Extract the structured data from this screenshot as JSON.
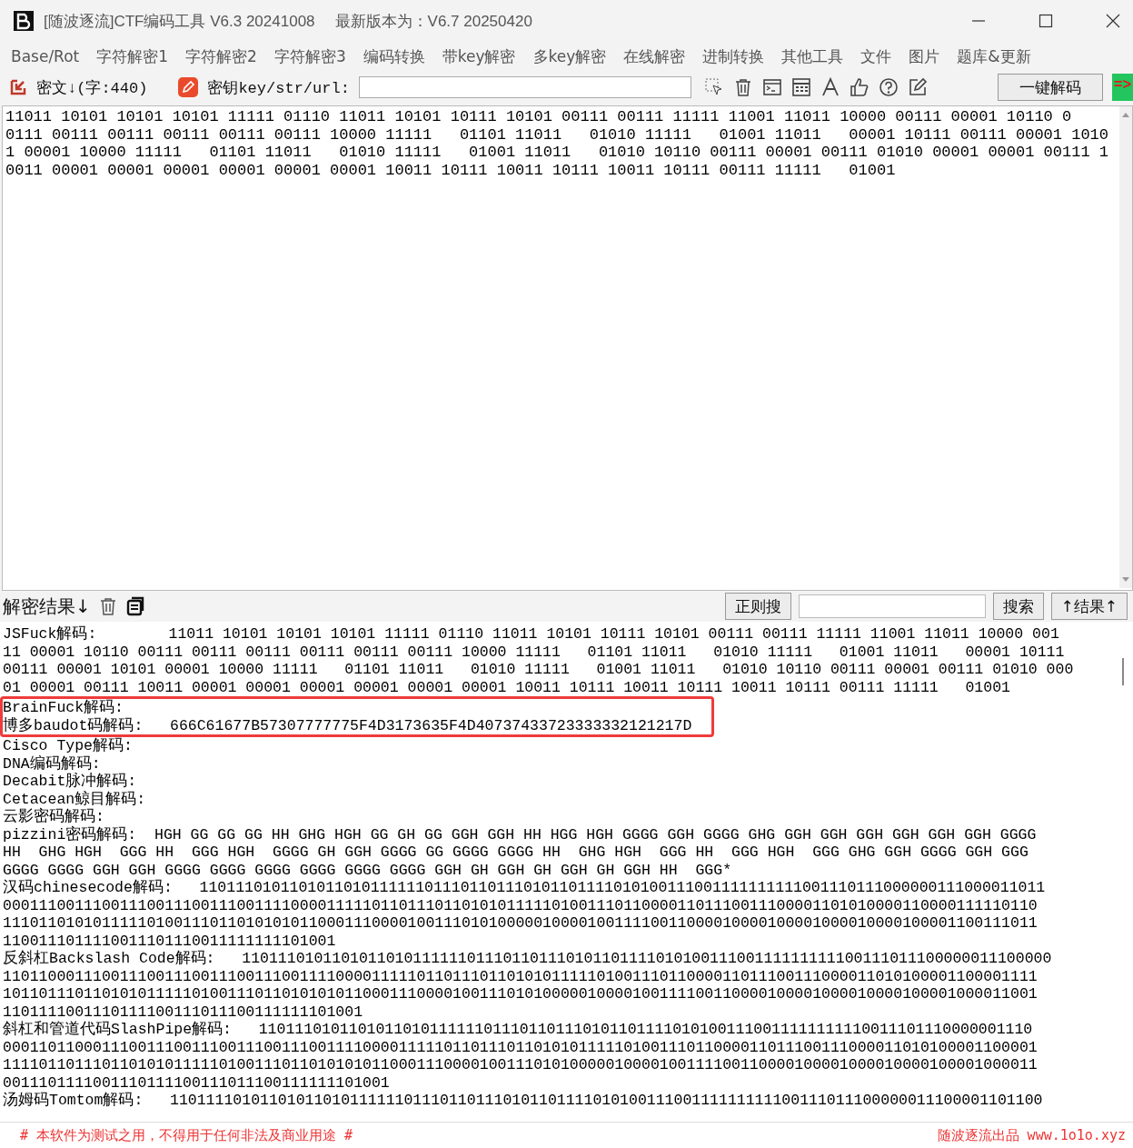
{
  "window": {
    "title": "[随波逐流]CTF编码工具 V6.3 20241008",
    "latest_version": "最新版本为：V6.7 20250420"
  },
  "menu": [
    "Base/Rot",
    "字符解密1",
    "字符解密2",
    "字符解密3",
    "编码转换",
    "带key解密",
    "多key解密",
    "在线解密",
    "进制转换",
    "其他工具",
    "文件",
    "图片",
    "题库&更新"
  ],
  "toolbar": {
    "input_label": "密文↓(字:440)",
    "key_label": "密钥key/str/url:",
    "decode_button": "一键解码",
    "arrow": "=>"
  },
  "input_lines": [
    "11011 10101 10101 10101 11111 01110 11011 10101 10111 10101 00111 00111 11111 11001 11011 10000 00111 00001 10110 0",
    "0111 00111 00111 00111 00111 00111 10000 11111   01101 11011   01010 11111   01001 11011   00001 10111 00111 00001 1010",
    "1 00001 10000 11111   01101 11011   01010 11111   01001 11011   01010 10110 00111 00001 00111 01010 00001 00001 00111 1",
    "0011 00001 00001 00001 00001 00001 00001 10011 10111 10011 10111 10011 10111 00111 11111   01001"
  ],
  "result_bar": {
    "label": "解密结果↓",
    "regex_button": "正则搜",
    "search_button": "搜索",
    "results_button": "↑结果↑"
  },
  "output_lines": [
    {
      "text": "JSFuck解码:        11011 10101 10101 10101 11111 01110 11011 10101 10111 10101 00111 00111 11111 11001 11011 10000 001",
      "highlighted": false
    },
    {
      "text": "11 00001 10110 00111 00111 00111 00111 00111 00111 10000 11111   01101 11011   01010 11111   01001 11011   00001 10111",
      "highlighted": false
    },
    {
      "text": "00111 00001 10101 00001 10000 11111   01101 11011   01010 11111   01001 11011   01010 10110 00111 00001 00111 01010 000",
      "highlighted": false
    },
    {
      "text": "01 00001 00111 10011 00001 00001 00001 00001 00001 00001 10011 10111 10011 10111 10011 10111 00111 11111   01001",
      "highlighted": false
    },
    {
      "text": "BrainFuck解码:",
      "highlighted": true
    },
    {
      "text": "博多baudot码解码:   666C61677B57307777775F4D3173635F4D40737433723333332121217D",
      "highlighted": true
    },
    {
      "text": "Cisco Type解码:",
      "highlighted": false
    },
    {
      "text": "DNA编码解码:",
      "highlighted": false
    },
    {
      "text": "Decabit脉冲解码:",
      "highlighted": false
    },
    {
      "text": "Cetacean鲸目解码:",
      "highlighted": false
    },
    {
      "text": "云影密码解码:",
      "highlighted": false
    },
    {
      "text": "pizzini密码解码:  HGH GG GG GG HH GHG HGH GG GH GG GGH GGH HH HGG HGH GGGG GGH GGGG GHG GGH GGH GGH GGH GGH GGH GGGG",
      "highlighted": false
    },
    {
      "text": "HH  GHG HGH  GGG HH  GGG HGH  GGGG GH GGH GGGG GG GGGG GGGG HH  GHG HGH  GGG HH  GGG HGH  GGG GHG GGH GGGG GGH GGG",
      "highlighted": false
    },
    {
      "text": "GGGG GGGG GGH GGH GGGG GGGG GGGG GGGG GGGG GGGG GGH GH GGH GH GGH GH GGH HH  GGG*",
      "highlighted": false
    },
    {
      "text": "汉码chinesecode解码:   1101110101101011010111111011101101110101101111010100111001111111111001110111000000111000011011",
      "highlighted": false
    },
    {
      "text": "0001110011100111001110011100111100001111101101110110101011111010011101100001101110011100001101010000110000111110110",
      "highlighted": false
    },
    {
      "text": "1110110101011111010011101101010101100011100001001110101000001000010011110011000010000100001000010000100001100111011",
      "highlighted": false
    },
    {
      "text": "1100111011110011101110011111111101001",
      "highlighted": false
    },
    {
      "text": "反斜杠Backslash Code解码:   110111010110101101011111101110110111010110111101010011100111111111100111011100000011100000",
      "highlighted": false
    },
    {
      "text": "1101100011100111001110011100111001111000011111011011101101010111110100111011000011011100111000011010100001100001111",
      "highlighted": false
    },
    {
      "text": "1011011101101010111110100111011010101011000111000010011101010000010000100111100110000100001000010000100001000011001",
      "highlighted": false
    },
    {
      "text": "1101111001110111100111011100111111101001",
      "highlighted": false
    },
    {
      "text": "斜杠和管道代码SlashPipe解码:   11011101011010110101111110111011011101011011110101001110011111111110011101110000001110",
      "highlighted": false
    },
    {
      "text": "0001101100011100111001110011100111001111000011111011011101101010111110100111011000011011100111000011010100001100001",
      "highlighted": false
    },
    {
      "text": "1111011011101101010111110100111011010101011000111000010011101010000010000100111100110000100001000010000100001000011",
      "highlighted": false
    },
    {
      "text": "0011101111001110111100111011100111111101001",
      "highlighted": false
    },
    {
      "text": "汤姆码Tomtom解码:   1101111010110101101011111101110110111010110111101010011100111111111100111011100000011100001101100",
      "highlighted": false
    }
  ],
  "footer": {
    "notice": "# 本软件为测试之用，不得用于任何非法及商业用途 #",
    "credit": "随波逐流出品 www.1o1o.xyz"
  }
}
